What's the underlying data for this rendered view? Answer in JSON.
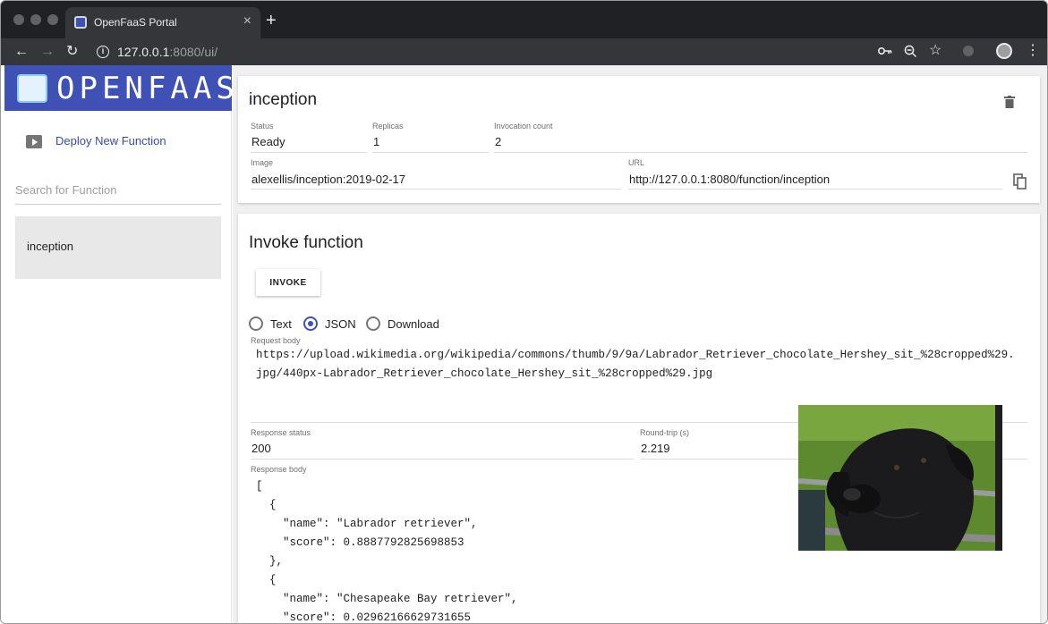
{
  "browser": {
    "tab_title": "OpenFaaS Portal",
    "tab_close": "×",
    "new_tab": "+",
    "url_host": "127.0.0.1",
    "url_path": ":8080/ui/"
  },
  "sidebar": {
    "logo_text": "OPENFAAS",
    "deploy_label": "Deploy New Function",
    "search_placeholder": "Search for Function",
    "functions": [
      {
        "label": "inception"
      }
    ]
  },
  "function_details": {
    "title": "inception",
    "status_label": "Status",
    "status_value": "Ready",
    "replicas_label": "Replicas",
    "replicas_value": "1",
    "invocations_label": "Invocation count",
    "invocations_value": "2",
    "image_label": "Image",
    "image_value": "alexellis/inception:2019-02-17",
    "url_label": "URL",
    "url_value": "http://127.0.0.1:8080/function/inception"
  },
  "invoke": {
    "title": "Invoke function",
    "button_label": "INVOKE",
    "response_types": [
      {
        "label": "Text",
        "checked": false
      },
      {
        "label": "JSON",
        "checked": true
      },
      {
        "label": "Download",
        "checked": false
      }
    ],
    "request_body_label": "Request body",
    "request_body_line1": "https://upload.wikimedia.org/wikipedia/commons/thumb/9/9a/Labrador_Retriever_chocolate_Hershey_sit_%28cropped%29.",
    "request_body_line2": "jpg/440px-Labrador_Retriever_chocolate_Hershey_sit_%28cropped%29.jpg",
    "response_status_label": "Response status",
    "response_status_value": "200",
    "roundtrip_label": "Round-trip (s)",
    "roundtrip_value": "2.219",
    "response_body_label": "Response body",
    "response_body": "[\n  {\n    \"name\": \"Labrador retriever\",\n    \"score\": 0.8887792825698853\n  },\n  {\n    \"name\": \"Chesapeake Bay retriever\",\n    \"score\": 0.02962166629731655"
  },
  "colors": {
    "brand": "#3f51b5",
    "link": "#3949ab",
    "chrome_dark": "#202124"
  }
}
